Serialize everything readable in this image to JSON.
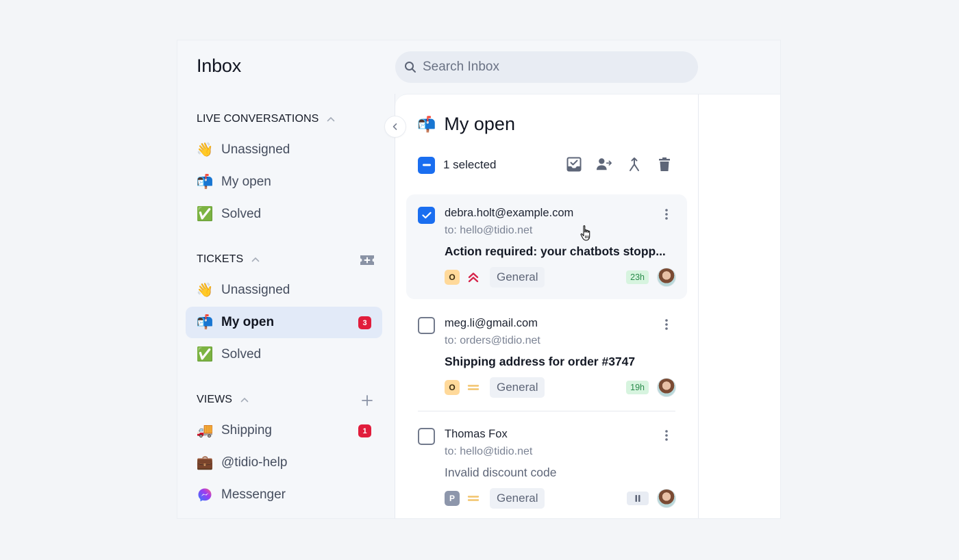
{
  "app": {
    "title": "Inbox"
  },
  "search": {
    "placeholder": "Search Inbox",
    "value": ""
  },
  "sidebar": {
    "sections": [
      {
        "title": "LIVE CONVERSATIONS",
        "collapse_icon": "chevron-up-icon",
        "items": [
          {
            "emoji": "👋",
            "icon": "waving-hand-icon",
            "label": "Unassigned"
          },
          {
            "emoji": "📬",
            "icon": "mailbox-icon",
            "label": "My open"
          },
          {
            "emoji": "✅",
            "icon": "check-mark-icon",
            "label": "Solved"
          }
        ]
      },
      {
        "title": "TICKETS",
        "collapse_icon": "chevron-up-icon",
        "action_icon": "add-ticket-icon",
        "items": [
          {
            "emoji": "👋",
            "icon": "waving-hand-icon",
            "label": "Unassigned"
          },
          {
            "emoji": "📬",
            "icon": "mailbox-icon",
            "label": "My open",
            "badge": "3",
            "active": true
          },
          {
            "emoji": "✅",
            "icon": "check-mark-icon",
            "label": "Solved"
          }
        ]
      },
      {
        "title": "VIEWS",
        "collapse_icon": "chevron-up-icon",
        "action_icon": "plus-icon",
        "items": [
          {
            "emoji": "🚚",
            "icon": "delivery-truck-icon",
            "label": "Shipping",
            "badge": "1"
          },
          {
            "emoji": "💼",
            "icon": "briefcase-icon",
            "label": "@tidio-help"
          },
          {
            "emoji": "💬",
            "icon": "messenger-icon",
            "label": "Messenger"
          }
        ]
      }
    ]
  },
  "list": {
    "title": "My open",
    "title_emoji": "📬",
    "selected_count_label": "1 selected",
    "bulk_actions": [
      "mark-solved",
      "assign",
      "merge",
      "delete"
    ],
    "conversations": [
      {
        "from": "debra.holt@example.com",
        "to": "to: hello@tidio.net",
        "subject": "Action required: your chatbots stopp...",
        "unread": true,
        "checked": true,
        "status": "O",
        "status_type": "open",
        "priority": "urgent",
        "tag": "General",
        "time": "23h"
      },
      {
        "from": "meg.li@gmail.com",
        "to": "to: orders@tidio.net",
        "subject": "Shipping address for order #3747",
        "unread": true,
        "checked": false,
        "status": "O",
        "status_type": "open",
        "priority": "medium",
        "tag": "General",
        "time": "19h"
      },
      {
        "from": "Thomas Fox",
        "to": "to: hello@tidio.net",
        "subject": "Invalid discount code",
        "unread": false,
        "checked": false,
        "status": "P",
        "status_type": "pending",
        "priority": "medium",
        "tag": "General",
        "time": "paused"
      }
    ]
  },
  "colors": {
    "accent": "#1a6ef0",
    "badge": "#e11d3c",
    "urgent": "#d6234a",
    "medium": "#f2c36b",
    "open_status": "#ffd99a",
    "pending_status": "#8d96ab",
    "time_chip_bg": "#d7f4df"
  }
}
